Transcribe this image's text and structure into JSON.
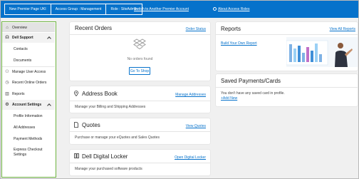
{
  "topbar": {
    "account_name": "New Premier Page UKI",
    "access_group": "Access Group : Management",
    "role": "Role : SiteAdmin",
    "switch_link": "Switch to Another Premier Account",
    "about_link": "About Access Roles"
  },
  "sidebar": {
    "overview": "Overview",
    "dell_support": "Dell Support",
    "contacts": "Contacts",
    "documents": "Documents",
    "manage_user_access": "Manage User Access",
    "recent_online_orders": "Recent Online Orders",
    "reports": "Reports",
    "account_settings": "Account Settings",
    "profile_information": "Profile Information",
    "all_addresses": "All Addresses",
    "payment_methods": "Payment Methods",
    "express_checkout_1": "Express Checkout",
    "express_checkout_2": "Settings"
  },
  "recent_orders": {
    "title": "Recent Orders",
    "link": "Order Status",
    "empty_text": "No orders found",
    "button": "Go To Shop"
  },
  "address_book": {
    "title": "Address Book",
    "link": "Manage Addresses",
    "text": "Manage your Billing and Shipping Addresses"
  },
  "quotes": {
    "title": "Quotes",
    "link": "View Quotes",
    "text": "Purchase or manage your eQuotes and Sales Quotes"
  },
  "digital_locker": {
    "title": "Dell Digital Locker",
    "link": "Open Digital Locker",
    "text": "Manage your purchased software products"
  },
  "reports": {
    "title": "Reports",
    "link": "View All Reports",
    "build_link": "Build Your Own Report"
  },
  "saved_payments": {
    "title": "Saved Payments/Cards",
    "text": "You don't have any saved card in profile.",
    "add_link": "+Add New"
  },
  "colors": {
    "brand_blue": "#0672cb",
    "sidebar_border": "#6db33f",
    "background": "#f0f0f0"
  }
}
